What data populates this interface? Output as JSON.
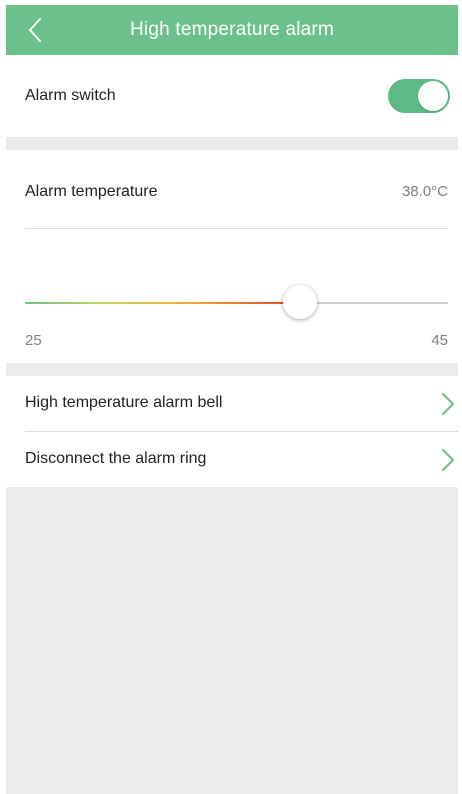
{
  "header": {
    "title": "High temperature alarm",
    "back_icon": "chevron-left-icon"
  },
  "alarm_switch": {
    "label": "Alarm switch",
    "enabled": true
  },
  "alarm_temperature": {
    "label": "Alarm temperature",
    "value_text": "38.0°C",
    "value": 38.0,
    "min": 25,
    "max": 45,
    "min_label": "25",
    "max_label": "45"
  },
  "menu": {
    "items": [
      {
        "label": "High temperature alarm bell",
        "icon": "chevron-right-icon"
      },
      {
        "label": "Disconnect the alarm ring",
        "icon": "chevron-right-icon"
      }
    ]
  },
  "colors": {
    "accent": "#6cc08b",
    "toggle_on": "#5fb986",
    "background": "#ebebea",
    "secondary_text": "#808080"
  }
}
